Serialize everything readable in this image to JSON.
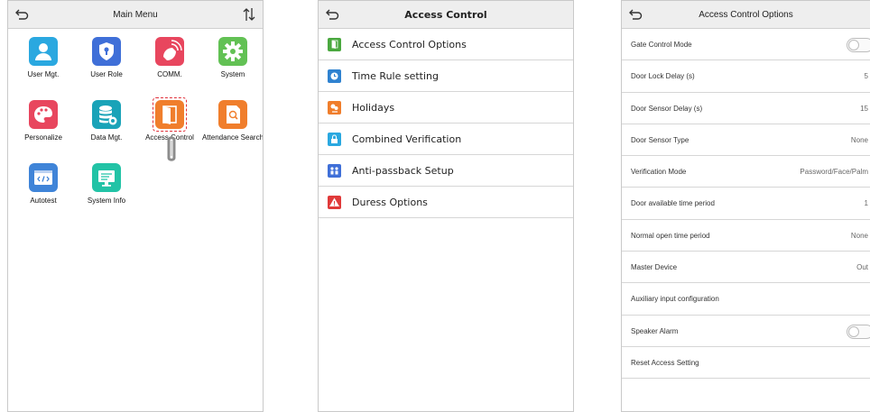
{
  "main_menu": {
    "title": "Main Menu",
    "back_icon": "back-arrow-icon",
    "sort_icon": "sort-arrows-icon",
    "items": [
      {
        "label": "User Mgt.",
        "icon": "user-icon",
        "color": "#2aa8e0"
      },
      {
        "label": "User Role",
        "icon": "shield-icon",
        "color": "#3f6fd8"
      },
      {
        "label": "COMM.",
        "icon": "satellite-icon",
        "color": "#e8465e"
      },
      {
        "label": "System",
        "icon": "gear-icon",
        "color": "#62c154"
      },
      {
        "label": "Personalize",
        "icon": "palette-icon",
        "color": "#e8465e"
      },
      {
        "label": "Data Mgt.",
        "icon": "database-icon",
        "color": "#1aa3b8"
      },
      {
        "label": "Access Control",
        "icon": "door-icon",
        "color": "#f07e2c"
      },
      {
        "label": "Attendance Search",
        "icon": "document-search-icon",
        "color": "#f07e2c"
      },
      {
        "label": "Autotest",
        "icon": "code-window-icon",
        "color": "#3f84d8"
      },
      {
        "label": "System Info",
        "icon": "monitor-icon",
        "color": "#22c3a6"
      }
    ],
    "selected": "Access Control"
  },
  "access_control": {
    "title": "Access Control",
    "items": [
      {
        "label": "Access Control Options",
        "icon": "door-icon",
        "color": "#4aa83f"
      },
      {
        "label": "Time Rule setting",
        "icon": "clock-icon",
        "color": "#2f82d0"
      },
      {
        "label": "Holidays",
        "icon": "holiday-icon",
        "color": "#f07e2c"
      },
      {
        "label": "Combined Verification",
        "icon": "lock-icon",
        "color": "#2aa8e0"
      },
      {
        "label": "Anti-passback Setup",
        "icon": "people-icon",
        "color": "#3f6fd8"
      },
      {
        "label": "Duress Options",
        "icon": "warning-icon",
        "color": "#e03a3a"
      }
    ]
  },
  "options": {
    "title": "Access Control Options",
    "rows": [
      {
        "label": "Gate Control Mode",
        "type": "toggle",
        "on": false
      },
      {
        "label": "Door Lock Delay (s)",
        "value": "5"
      },
      {
        "label": "Door Sensor Delay (s)",
        "value": "15"
      },
      {
        "label": "Door Sensor Type",
        "value": "None"
      },
      {
        "label": "Verification Mode",
        "value": "Password/Face/Palm"
      },
      {
        "label": "Door available time period",
        "value": "1"
      },
      {
        "label": "Normal open time period",
        "value": "None"
      },
      {
        "label": "Master Device",
        "value": "Out"
      },
      {
        "label": "Auxiliary input configuration",
        "value": ""
      },
      {
        "label": "Speaker Alarm",
        "type": "toggle",
        "on": false
      },
      {
        "label": "Reset Access Setting",
        "value": ""
      }
    ]
  }
}
